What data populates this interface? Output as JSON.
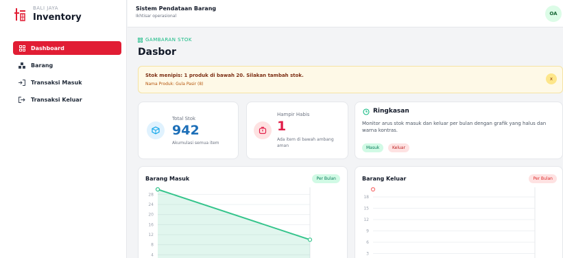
{
  "brand": {
    "sub": "BALI JAYA",
    "name": "Inventory"
  },
  "nav": [
    {
      "label": "Dashboard",
      "icon": "grid-icon"
    },
    {
      "label": "Barang",
      "icon": "boxes-icon"
    },
    {
      "label": "Transaksi Masuk",
      "icon": "sign-in-icon"
    },
    {
      "label": "Transaksi Keluar",
      "icon": "sign-out-icon"
    }
  ],
  "topbar": {
    "title": "Sistem Pendataan Barang",
    "subtitle": "Ikhtisar operasional",
    "avatar": "OA"
  },
  "header": {
    "section": "GAMBARAN STOK",
    "title": "Dasbor"
  },
  "alert": {
    "title": "Stok menipis: 1 produk di bawah 20. Silakan tambah stok.",
    "detail": "Nama Produk: Gula Pasir (8)",
    "close": "x"
  },
  "stats": {
    "total": {
      "label": "Total Stok",
      "value": "942",
      "desc": "Akumulasi semua item"
    },
    "low": {
      "label": "Hampir Habis",
      "value": "1",
      "desc_line1": "Ada item di bawah ambang",
      "desc_line2": "aman"
    }
  },
  "summary": {
    "title": "Ringkasan",
    "text": "Monitor arus stok masuk dan keluar per bulan dengan grafik yang halus dan warna kontras.",
    "tags": [
      "Masuk",
      "Keluar"
    ]
  },
  "colors": {
    "accent": "#e11d34",
    "masuk": "#34c48b",
    "keluar": "#f87171",
    "stat_blue": "#1d6fb8",
    "stat_red": "#e11d48"
  },
  "chart_data": [
    {
      "type": "area",
      "title": "Barang Masuk",
      "badge": "Per Bulan",
      "y_ticks": [
        28,
        24,
        20,
        16,
        12,
        8,
        4
      ],
      "ylim": [
        0,
        30
      ],
      "series": [
        {
          "values": [
            30,
            10
          ]
        }
      ]
    },
    {
      "type": "line",
      "title": "Barang Keluar",
      "badge": "Per Bulan",
      "y_ticks": [
        18,
        15,
        12,
        9,
        6,
        3
      ],
      "ylim": [
        0,
        20
      ],
      "series": [
        {
          "values": [
            20
          ]
        }
      ]
    }
  ]
}
